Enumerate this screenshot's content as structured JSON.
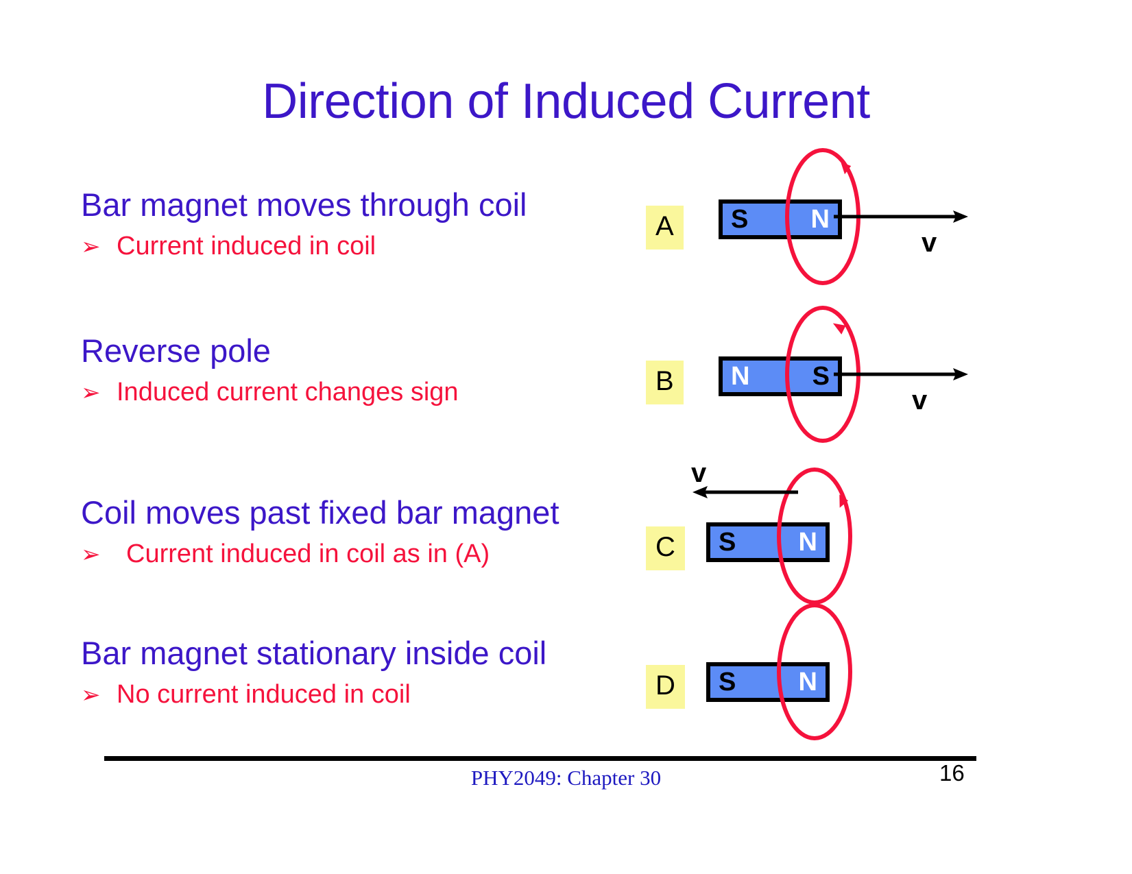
{
  "slide": {
    "title": "Direction of Induced Current",
    "title_color": "#3C17C8",
    "body_heading_color": "#3C17C8",
    "bullet_color": "#F5123C",
    "magnet_fill_color": "#5C8CF6",
    "coil_color": "#F5123C",
    "tag_highlight_color": "#FAF79C",
    "bullet_marker": "➢"
  },
  "blocks": [
    {
      "heading": "Bar magnet moves through coil",
      "bullet": "Current induced in coil"
    },
    {
      "heading": "Reverse pole",
      "bullet": "Induced current changes sign"
    },
    {
      "heading": "Coil moves past fixed bar magnet",
      "bullet": "Current induced in coil as in (A)"
    },
    {
      "heading": "Bar magnet stationary inside coil",
      "bullet": "No current induced in coil"
    }
  ],
  "diagrams": [
    {
      "tag": "A",
      "magnet_left_pole": "S",
      "magnet_right_pole": "N",
      "velocity_label": "v",
      "velocity_direction": "right",
      "current_arrow": "counterclockwise-top-right"
    },
    {
      "tag": "B",
      "magnet_left_pole": "N",
      "magnet_right_pole": "S",
      "velocity_label": "v",
      "velocity_direction": "right",
      "current_arrow": "clockwise-top-right"
    },
    {
      "tag": "C",
      "magnet_left_pole": "S",
      "magnet_right_pole": "N",
      "velocity_label": "v",
      "velocity_direction": "left",
      "current_arrow": "counterclockwise-right"
    },
    {
      "tag": "D",
      "magnet_left_pole": "S",
      "magnet_right_pole": "N",
      "velocity_label": "",
      "velocity_direction": "none",
      "current_arrow": "none"
    }
  ],
  "footer": {
    "course": "PHY2049: Chapter 30",
    "page_number": "16"
  }
}
